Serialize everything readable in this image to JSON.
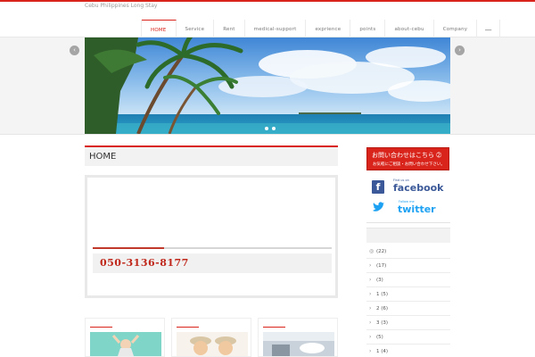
{
  "site": {
    "tagline": "Cebu Philippines Long Stay"
  },
  "nav": {
    "items": [
      {
        "label": "HOME",
        "active": true
      },
      {
        "label": "Service",
        "active": false
      },
      {
        "label": "Rent",
        "active": false
      },
      {
        "label": "medical-support",
        "active": false
      },
      {
        "label": "exprience",
        "active": false
      },
      {
        "label": "points",
        "active": false
      },
      {
        "label": "about-cebu",
        "active": false
      },
      {
        "label": "Company",
        "active": false
      }
    ],
    "more_icon": "menu-icon"
  },
  "slider": {
    "prev_icon": "chevron-left-icon",
    "next_icon": "chevron-right-icon",
    "slide_count": 2,
    "active_slide": 2
  },
  "main": {
    "page_title": "HOME",
    "phone": "050-3136-8177"
  },
  "sidebar": {
    "contact": {
      "title": "お問い合わせはこちら ➁",
      "subtitle": "お気軽にご相談・お問い合わせ下さい。"
    },
    "facebook": {
      "small": "Find us on",
      "label": "facebook"
    },
    "twitter": {
      "small": "Follow me",
      "label": "twitter"
    },
    "list": [
      {
        "icon": "rss-icon",
        "text": "(22)"
      },
      {
        "icon": "chevron-right-icon",
        "text": "(17)"
      },
      {
        "icon": "chevron-right-icon",
        "text": "(3)"
      },
      {
        "icon": "chevron-right-icon",
        "text": "1 (5)"
      },
      {
        "icon": "chevron-right-icon",
        "text": "2 (6)"
      },
      {
        "icon": "chevron-right-icon",
        "text": "3 (3)"
      },
      {
        "icon": "chevron-right-icon",
        "text": "(5)"
      },
      {
        "icon": "chevron-right-icon",
        "text": "1 (4)"
      }
    ]
  },
  "colors": {
    "accent": "#d9241b",
    "phone_text": "#c0281c",
    "facebook": "#3b5998",
    "twitter": "#1da1f2"
  }
}
